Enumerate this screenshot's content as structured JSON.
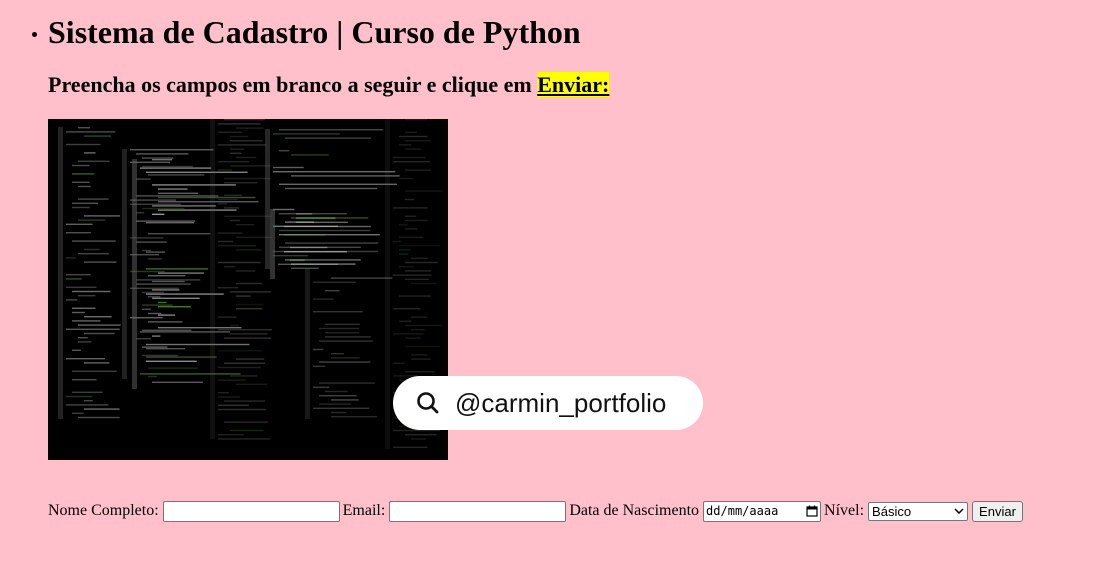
{
  "header": {
    "title": "Sistema de Cadastro | Curso de Python",
    "instructions_prefix": "Preencha os campos em branco a seguir e clique em",
    "instructions_highlight": "Enviar:"
  },
  "image": {
    "handle": "@carmin_portfolio",
    "icon": "search-icon",
    "colors": {
      "background": "#000000",
      "code": "#c8c8c8",
      "accent": "#6ab04c"
    }
  },
  "form": {
    "name_label": "Nome Completo:",
    "name_value": "",
    "email_label": "Email:",
    "email_value": "",
    "birth_label": "Data de Nascimento",
    "birth_placeholder": "dd/mm/aaaa",
    "level_label": "Nível:",
    "level_selected": "Básico",
    "submit_label": "Enviar"
  },
  "colors": {
    "page_background": "#ffc0cb",
    "highlight": "#ffff00"
  }
}
